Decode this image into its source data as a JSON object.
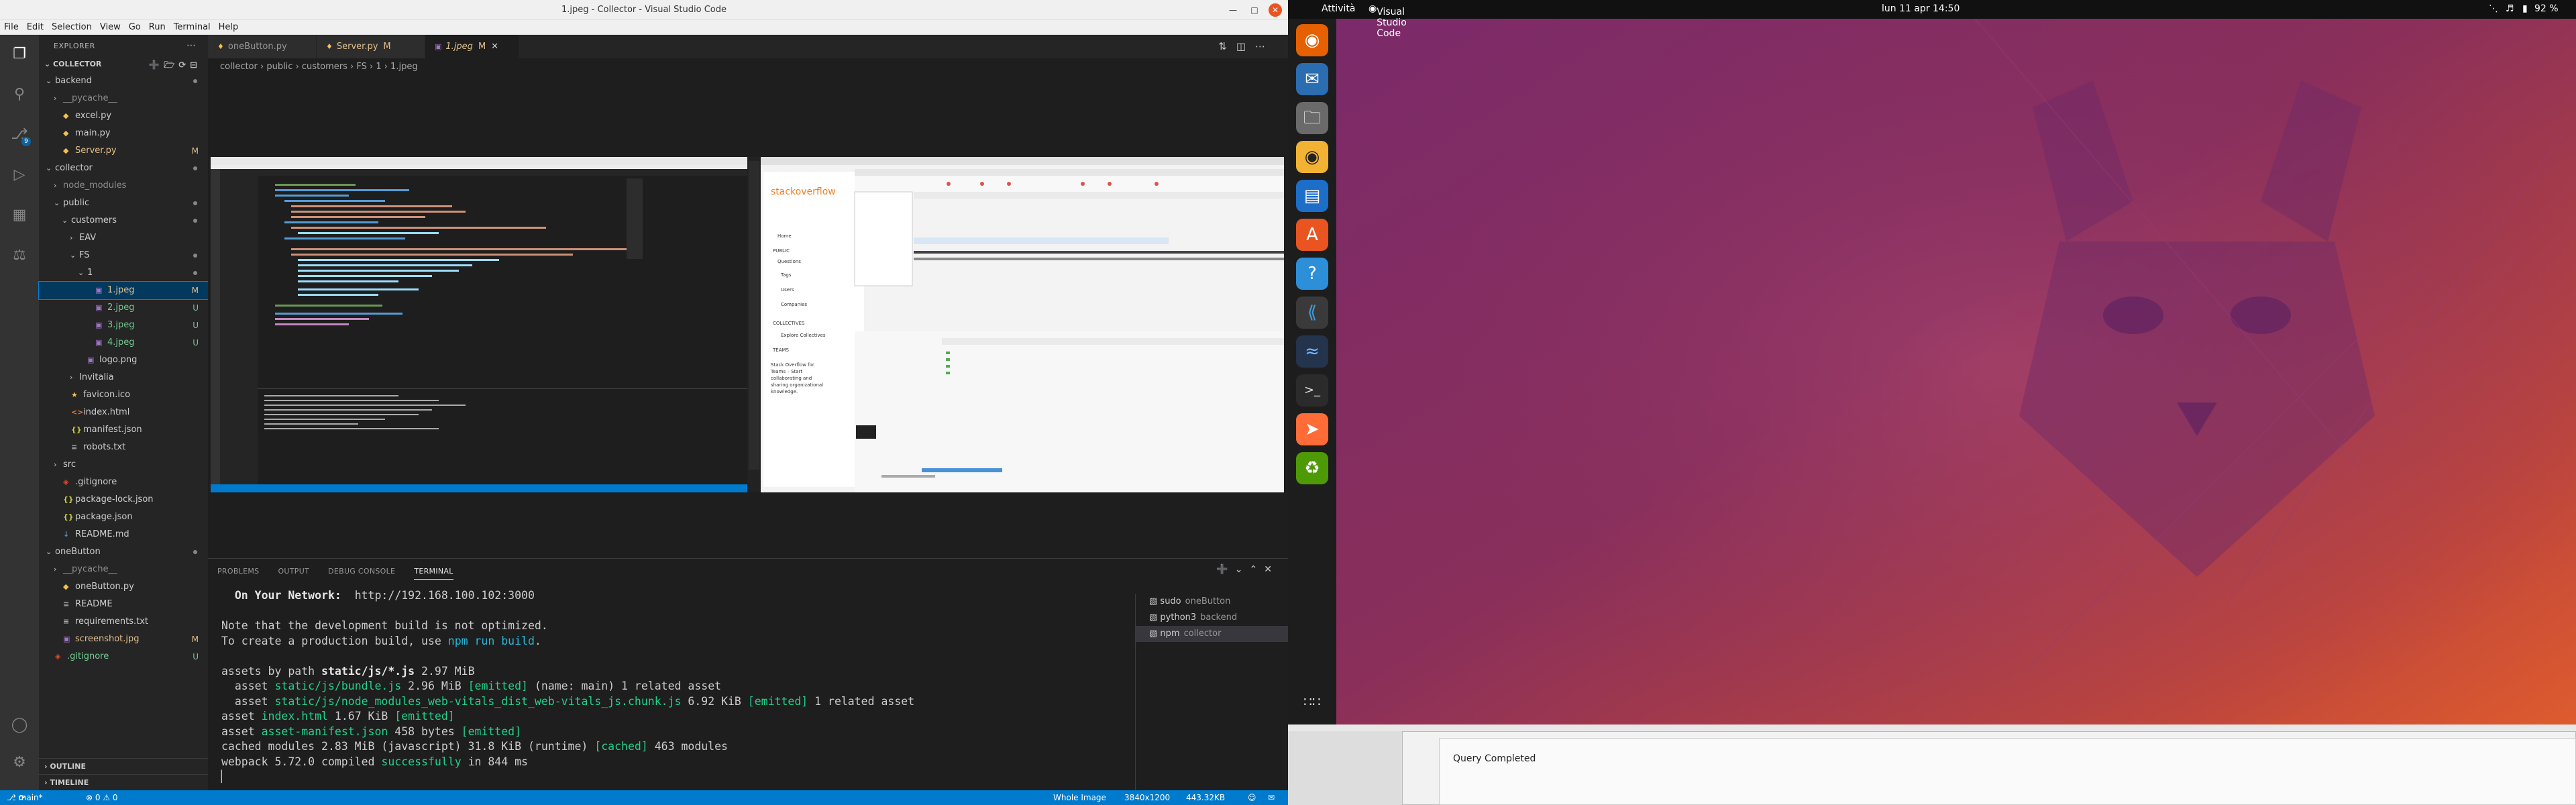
{
  "window": {
    "title": "1.jpeg - Collector - Visual Studio Code"
  },
  "menu": [
    "File",
    "Edit",
    "Selection",
    "View",
    "Go",
    "Run",
    "Terminal",
    "Help"
  ],
  "explorer": {
    "header": "EXPLORER",
    "project": "COLLECTOR",
    "tree": [
      {
        "label": "backend",
        "depth": 0,
        "type": "folder",
        "open": true,
        "status": "dot"
      },
      {
        "label": "__pycache__",
        "depth": 1,
        "type": "folder",
        "open": false,
        "status": ""
      },
      {
        "label": "excel.py",
        "depth": 1,
        "type": "py",
        "status": ""
      },
      {
        "label": "main.py",
        "depth": 1,
        "type": "py",
        "status": ""
      },
      {
        "label": "Server.py",
        "depth": 1,
        "type": "py",
        "status": "M"
      },
      {
        "label": "collector",
        "depth": 0,
        "type": "folder",
        "open": true,
        "status": "dot"
      },
      {
        "label": "node_modules",
        "depth": 1,
        "type": "folder",
        "open": false,
        "status": ""
      },
      {
        "label": "public",
        "depth": 1,
        "type": "folder",
        "open": true,
        "status": "dot"
      },
      {
        "label": "customers",
        "depth": 2,
        "type": "folder",
        "open": true,
        "status": "dot"
      },
      {
        "label": "EAV",
        "depth": 3,
        "type": "folder",
        "open": false,
        "status": ""
      },
      {
        "label": "FS",
        "depth": 3,
        "type": "folder",
        "open": true,
        "status": "dot"
      },
      {
        "label": "1",
        "depth": 4,
        "type": "folder",
        "open": true,
        "status": "dot"
      },
      {
        "label": "1.jpeg",
        "depth": 5,
        "type": "img",
        "status": "M",
        "selected": true
      },
      {
        "label": "2.jpeg",
        "depth": 5,
        "type": "img",
        "status": "U"
      },
      {
        "label": "3.jpeg",
        "depth": 5,
        "type": "img",
        "status": "U"
      },
      {
        "label": "4.jpeg",
        "depth": 5,
        "type": "img",
        "status": "U"
      },
      {
        "label": "logo.png",
        "depth": 4,
        "type": "img",
        "status": ""
      },
      {
        "label": "Invitalia",
        "depth": 3,
        "type": "folder",
        "open": false,
        "status": ""
      },
      {
        "label": "favicon.ico",
        "depth": 2,
        "type": "ico",
        "status": ""
      },
      {
        "label": "index.html",
        "depth": 2,
        "type": "html",
        "status": ""
      },
      {
        "label": "manifest.json",
        "depth": 2,
        "type": "json",
        "status": ""
      },
      {
        "label": "robots.txt",
        "depth": 2,
        "type": "txt",
        "status": ""
      },
      {
        "label": "src",
        "depth": 1,
        "type": "folder",
        "open": false,
        "status": ""
      },
      {
        "label": ".gitignore",
        "depth": 1,
        "type": "git",
        "status": ""
      },
      {
        "label": "package-lock.json",
        "depth": 1,
        "type": "json",
        "status": ""
      },
      {
        "label": "package.json",
        "depth": 1,
        "type": "json",
        "status": ""
      },
      {
        "label": "README.md",
        "depth": 1,
        "type": "md",
        "status": ""
      },
      {
        "label": "oneButton",
        "depth": 0,
        "type": "folder",
        "open": true,
        "status": "dot"
      },
      {
        "label": "__pycache__",
        "depth": 1,
        "type": "folder",
        "open": false,
        "status": ""
      },
      {
        "label": "oneButton.py",
        "depth": 1,
        "type": "py",
        "status": ""
      },
      {
        "label": "README",
        "depth": 1,
        "type": "txt",
        "status": ""
      },
      {
        "label": "requirements.txt",
        "depth": 1,
        "type": "txt",
        "status": ""
      },
      {
        "label": "screenshot.jpg",
        "depth": 1,
        "type": "img",
        "status": "M"
      },
      {
        "label": ".gitignore",
        "depth": 0,
        "type": "git",
        "status": "U"
      }
    ],
    "outline": "OUTLINE",
    "timeline": "TIMELINE"
  },
  "tabs": [
    {
      "label": "oneButton.py",
      "mod": "",
      "active": false
    },
    {
      "label": "Server.py",
      "mod": "M",
      "active": false
    },
    {
      "label": "1.jpeg",
      "mod": "M",
      "active": true
    }
  ],
  "breadcrumb": "collector › public › customers › FS › 1 ›  1.jpeg",
  "panel": {
    "tabs": [
      "PROBLEMS",
      "OUTPUT",
      "DEBUG CONSOLE",
      "TERMINAL"
    ],
    "terminal": {
      "network_label": "  On Your Network:  ",
      "network_url": "http://192.168.100.102:3000",
      "note1": "Note that the development build is not optimized.",
      "note2a": "To create a production build, use ",
      "note2b": "npm run build",
      "note2c": ".",
      "assets_by": "assets by path ",
      "assets_path": "static/js/*.js",
      "assets_size": " 2.97 MiB",
      "asset1_pre": "  asset ",
      "asset1_name": "static/js/bundle.js",
      "asset1_size": " 2.96 MiB ",
      "asset1_tag": "[emitted]",
      "asset1_rest": " (name: main) 1 related asset",
      "asset2_name": "static/js/node_modules_web-vitals_dist_web-vitals_js.chunk.js",
      "asset2_size": " 6.92 KiB ",
      "asset2_rest": " 1 related asset",
      "asset3_pre": "asset ",
      "asset3_name": "index.html",
      "asset3_size": " 1.67 KiB ",
      "asset4_name": "asset-manifest.json",
      "asset4_size": " 458 bytes ",
      "cached_pre": "cached modules 2.83 MiB (javascript) 31.8 KiB (runtime) ",
      "cached_tag": "[cached]",
      "cached_rest": " 463 modules",
      "webpack_pre": "webpack 5.72.0 compiled ",
      "webpack_ok": "successfully",
      "webpack_rest": " in 844 ms",
      "cursor": "▏"
    },
    "terminals": [
      {
        "name": "sudo",
        "cwd": "oneButton"
      },
      {
        "name": "python3",
        "cwd": "backend"
      },
      {
        "name": "npm",
        "cwd": "collector",
        "selected": true
      }
    ]
  },
  "status": {
    "branch": "main*",
    "errors": "⊗ 0 ⚠ 0",
    "whole_image": "Whole Image",
    "dims": "3840x1200",
    "size": "443.32KB"
  },
  "ubuntu": {
    "activities": "Attività",
    "app": "Visual Studio Code",
    "clock": "lun 11 apr  14:50",
    "battery": "92 %",
    "query": "Query Completed"
  }
}
